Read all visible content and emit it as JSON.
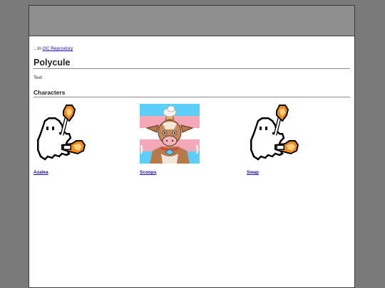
{
  "breadcrumb": {
    "prefix": "...In",
    "link": "OC Repository"
  },
  "page": {
    "title": "Polycule",
    "body": "Text"
  },
  "characters": {
    "heading": "Characters",
    "items": [
      {
        "name": "Azalea",
        "icon": "pixel-ghost-torch-icon"
      },
      {
        "name": "Scoops",
        "icon": "cow-icecream-portrait"
      },
      {
        "name": "Swap",
        "icon": "pixel-ghost-torch-icon"
      }
    ]
  }
}
